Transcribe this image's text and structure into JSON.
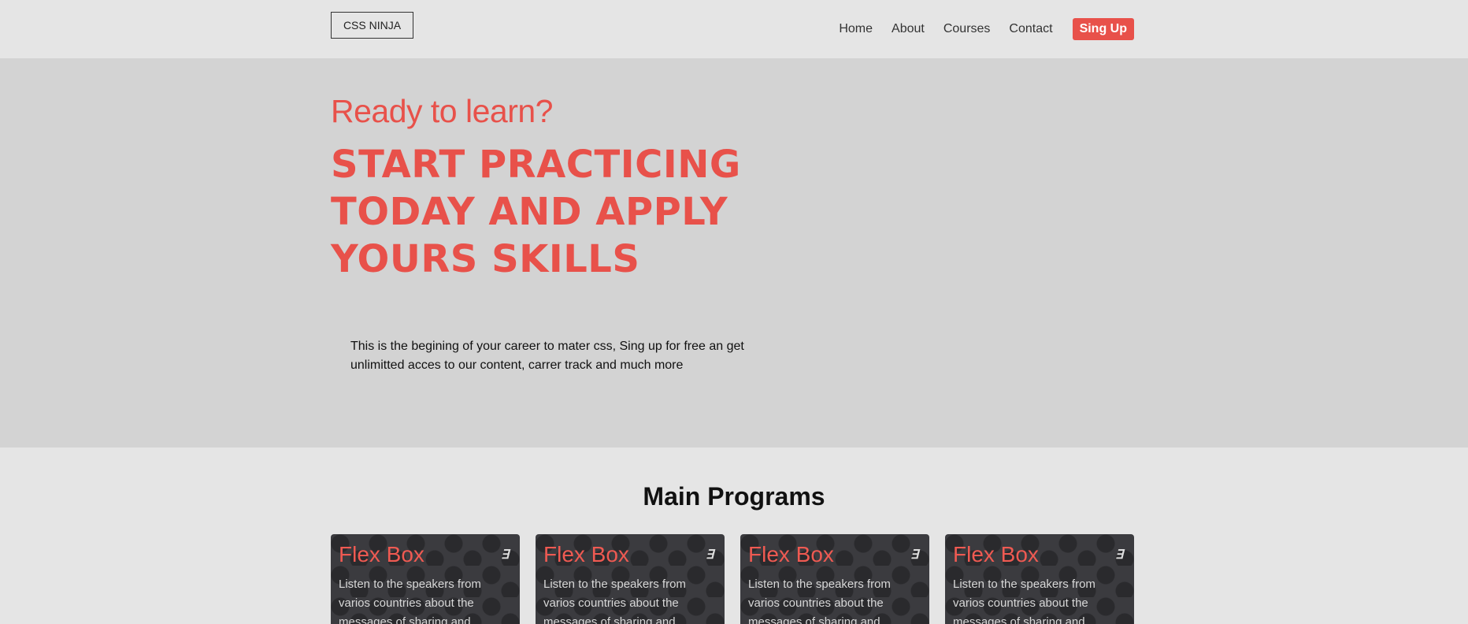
{
  "header": {
    "logo": "CSS NINJA",
    "nav": [
      {
        "label": "Home"
      },
      {
        "label": "About"
      },
      {
        "label": "Courses"
      },
      {
        "label": "Contact"
      }
    ],
    "signup": "Sing Up"
  },
  "hero": {
    "kicker": "Ready to learn?",
    "title": "START PRACTICING TODAY AND APPLY YOURS SKILLS",
    "description": "This is the begining of your career to mater css, Sing up for free an get unlimitted acces to our content, carrer track and much more"
  },
  "programs": {
    "title": "Main Programs",
    "cards": [
      {
        "title": "Flex Box",
        "text": "Listen to the speakers from varios countries about the messages of sharing and",
        "icon": "css3-icon"
      },
      {
        "title": "Flex Box",
        "text": "Listen to the speakers from varios countries about the messages of sharing and",
        "icon": "css3-icon"
      },
      {
        "title": "Flex Box",
        "text": "Listen to the speakers from varios countries about the messages of sharing and",
        "icon": "css3-icon"
      },
      {
        "title": "Flex Box",
        "text": "Listen to the speakers from varios countries about the messages of sharing and",
        "icon": "css3-icon"
      }
    ]
  },
  "colors": {
    "accent": "#e8514a",
    "hero_bg": "#d3d3d3",
    "page_bg": "#e5e5e5",
    "card_bg": "#3b3b3f"
  }
}
